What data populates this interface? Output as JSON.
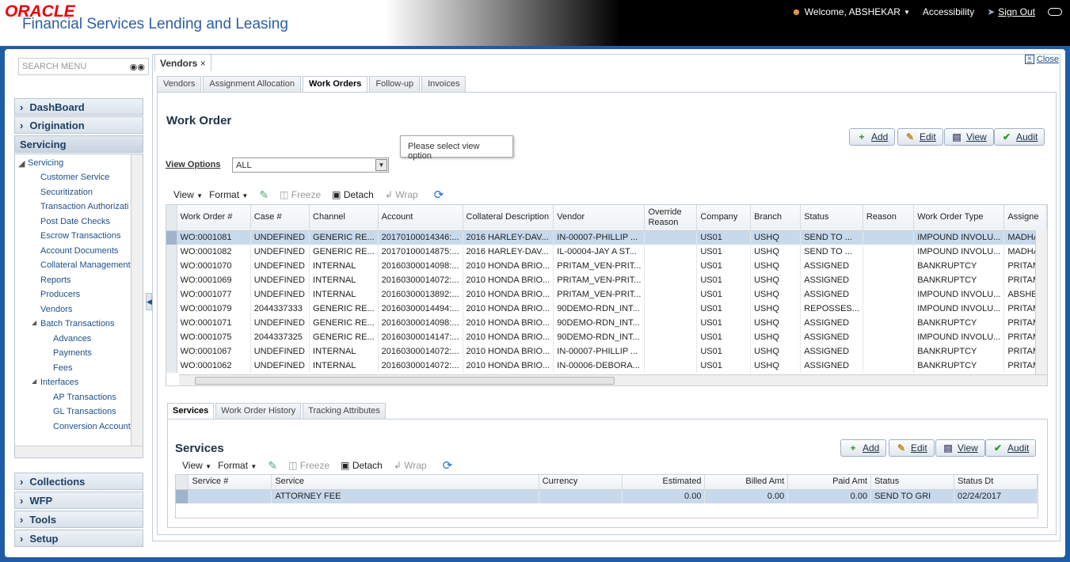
{
  "header": {
    "brand": "ORACLE",
    "product": "Financial Services Lending and Leasing",
    "welcome": "Welcome, ABSHEKAR",
    "accessibility": "Accessibility",
    "sign_out": "Sign Out"
  },
  "sidebar": {
    "search_placeholder": "SEARCH MENU",
    "sections_top": [
      "DashBoard",
      "Origination",
      "Servicing"
    ],
    "tree": [
      {
        "label": "Servicing",
        "level": 0
      },
      {
        "label": "Customer Service",
        "level": 1
      },
      {
        "label": "Securitization",
        "level": 1
      },
      {
        "label": "Transaction Authorizati",
        "level": 1
      },
      {
        "label": "Post Date Checks",
        "level": 1
      },
      {
        "label": "Escrow Transactions",
        "level": 1
      },
      {
        "label": "Account Documents",
        "level": 1
      },
      {
        "label": "Collateral Management",
        "level": 1
      },
      {
        "label": "Reports",
        "level": 1
      },
      {
        "label": "Producers",
        "level": 1
      },
      {
        "label": "Vendors",
        "level": 1
      },
      {
        "label": "Batch Transactions",
        "level": 1
      },
      {
        "label": "Advances",
        "level": 2
      },
      {
        "label": "Payments",
        "level": 2
      },
      {
        "label": "Fees",
        "level": 2
      },
      {
        "label": "Interfaces",
        "level": 1
      },
      {
        "label": "AP Transactions",
        "level": 2
      },
      {
        "label": "GL Transactions",
        "level": 2
      },
      {
        "label": "Conversion Account",
        "level": 2
      }
    ],
    "sections_bottom": [
      "Collections",
      "WFP",
      "Tools",
      "Setup"
    ]
  },
  "main_tab": "Vendors",
  "close_label": "Close",
  "subtabs": [
    "Vendors",
    "Assignment Allocation",
    "Work Orders",
    "Follow-up",
    "Invoices"
  ],
  "active_subtab": "Work Orders",
  "work_order": {
    "title": "Work Order",
    "buttons": {
      "add": "Add",
      "edit": "Edit",
      "view": "View",
      "audit": "Audit"
    },
    "tooltip": "Please select view option",
    "view_options_label": "View Options",
    "view_options_value": "ALL",
    "toolbar": {
      "view": "View",
      "format": "Format",
      "freeze": "Freeze",
      "detach": "Detach",
      "wrap": "Wrap"
    },
    "columns": [
      "Work Order #",
      "Case #",
      "Channel",
      "Account",
      "Collateral Description",
      "Vendor",
      "Override Reason",
      "Company",
      "Branch",
      "Status",
      "Reason",
      "Work Order Type",
      "Assigne"
    ],
    "rows": [
      [
        "WO:0001081",
        "UNDEFINED",
        "GENERIC RE...",
        "20170100014346:...",
        "2016 HARLEY-DAV...",
        "IN-00007-PHILLIP ...",
        "",
        "US01",
        "USHQ",
        "SEND TO ...",
        "",
        "IMPOUND INVOLU...",
        "MADHA"
      ],
      [
        "WO:0001082",
        "UNDEFINED",
        "GENERIC RE...",
        "20170100014875:...",
        "2016 HARLEY-DAV...",
        "IL-00004-JAY A ST...",
        "",
        "US01",
        "USHQ",
        "SEND TO ...",
        "",
        "IMPOUND INVOLU...",
        "MADHA"
      ],
      [
        "WO:0001070",
        "UNDEFINED",
        "INTERNAL",
        "20160300014098:...",
        "2010 HONDA BRIO...",
        "PRITAM_VEN-PRIT...",
        "",
        "US01",
        "USHQ",
        "ASSIGNED",
        "",
        "BANKRUPTCY",
        "PRITAM"
      ],
      [
        "WO:0001069",
        "UNDEFINED",
        "INTERNAL",
        "20160300014072:...",
        "2010 HONDA BRIO...",
        "PRITAM_VEN-PRIT...",
        "",
        "US01",
        "USHQ",
        "ASSIGNED",
        "",
        "BANKRUPTCY",
        "PRITAM"
      ],
      [
        "WO:0001077",
        "UNDEFINED",
        "INTERNAL",
        "20160300013892:...",
        "2010 HONDA BRIO...",
        "PRITAM_VEN-PRIT...",
        "",
        "US01",
        "USHQ",
        "ASSIGNED",
        "",
        "IMPOUND INVOLU...",
        "ABSHEK"
      ],
      [
        "WO:0001079",
        "2044337333",
        "GENERIC RE...",
        "20160300014494:...",
        "2010 HONDA BRIO...",
        "90DEMO-RDN_INT...",
        "",
        "US01",
        "USHQ",
        "REPOSSES...",
        "",
        "IMPOUND INVOLU...",
        "PRITAM"
      ],
      [
        "WO:0001071",
        "UNDEFINED",
        "GENERIC RE...",
        "20160300014098:...",
        "2010 HONDA BRIO...",
        "90DEMO-RDN_INT...",
        "",
        "US01",
        "USHQ",
        "ASSIGNED",
        "",
        "BANKRUPTCY",
        "PRITAM"
      ],
      [
        "WO:0001075",
        "2044337325",
        "GENERIC RE...",
        "20160300014147:...",
        "2010 HONDA BRIO...",
        "90DEMO-RDN_INT...",
        "",
        "US01",
        "USHQ",
        "ASSIGNED",
        "",
        "IMPOUND INVOLU...",
        "PRITAM"
      ],
      [
        "WO:0001067",
        "UNDEFINED",
        "INTERNAL",
        "20160300014072:...",
        "2010 HONDA BRIO...",
        "IN-00007-PHILLIP ...",
        "",
        "US01",
        "USHQ",
        "ASSIGNED",
        "",
        "BANKRUPTCY",
        "PRITAM"
      ],
      [
        "WO:0001062",
        "UNDEFINED",
        "INTERNAL",
        "20160300014072:...",
        "2010 HONDA BRIO...",
        "IN-00006-DEBORA...",
        "",
        "US01",
        "USHQ",
        "ASSIGNED",
        "",
        "BANKRUPTCY",
        "PRITAM"
      ]
    ]
  },
  "bottom_tabs": [
    "Services",
    "Work Order History",
    "Tracking Attributes"
  ],
  "services": {
    "title": "Services",
    "buttons": {
      "add": "Add",
      "edit": "Edit",
      "view": "View",
      "audit": "Audit"
    },
    "toolbar": {
      "view": "View",
      "format": "Format",
      "freeze": "Freeze",
      "detach": "Detach",
      "wrap": "Wrap"
    },
    "columns": [
      "Service #",
      "Service",
      "Currency",
      "Estimated",
      "Billed Amt",
      "Paid Amt",
      "Status",
      "Status Dt"
    ],
    "rows": [
      [
        "",
        "ATTORNEY FEE",
        "",
        "0.00",
        "0.00",
        "0.00",
        "SEND TO GRI",
        "02/24/2017"
      ]
    ]
  }
}
